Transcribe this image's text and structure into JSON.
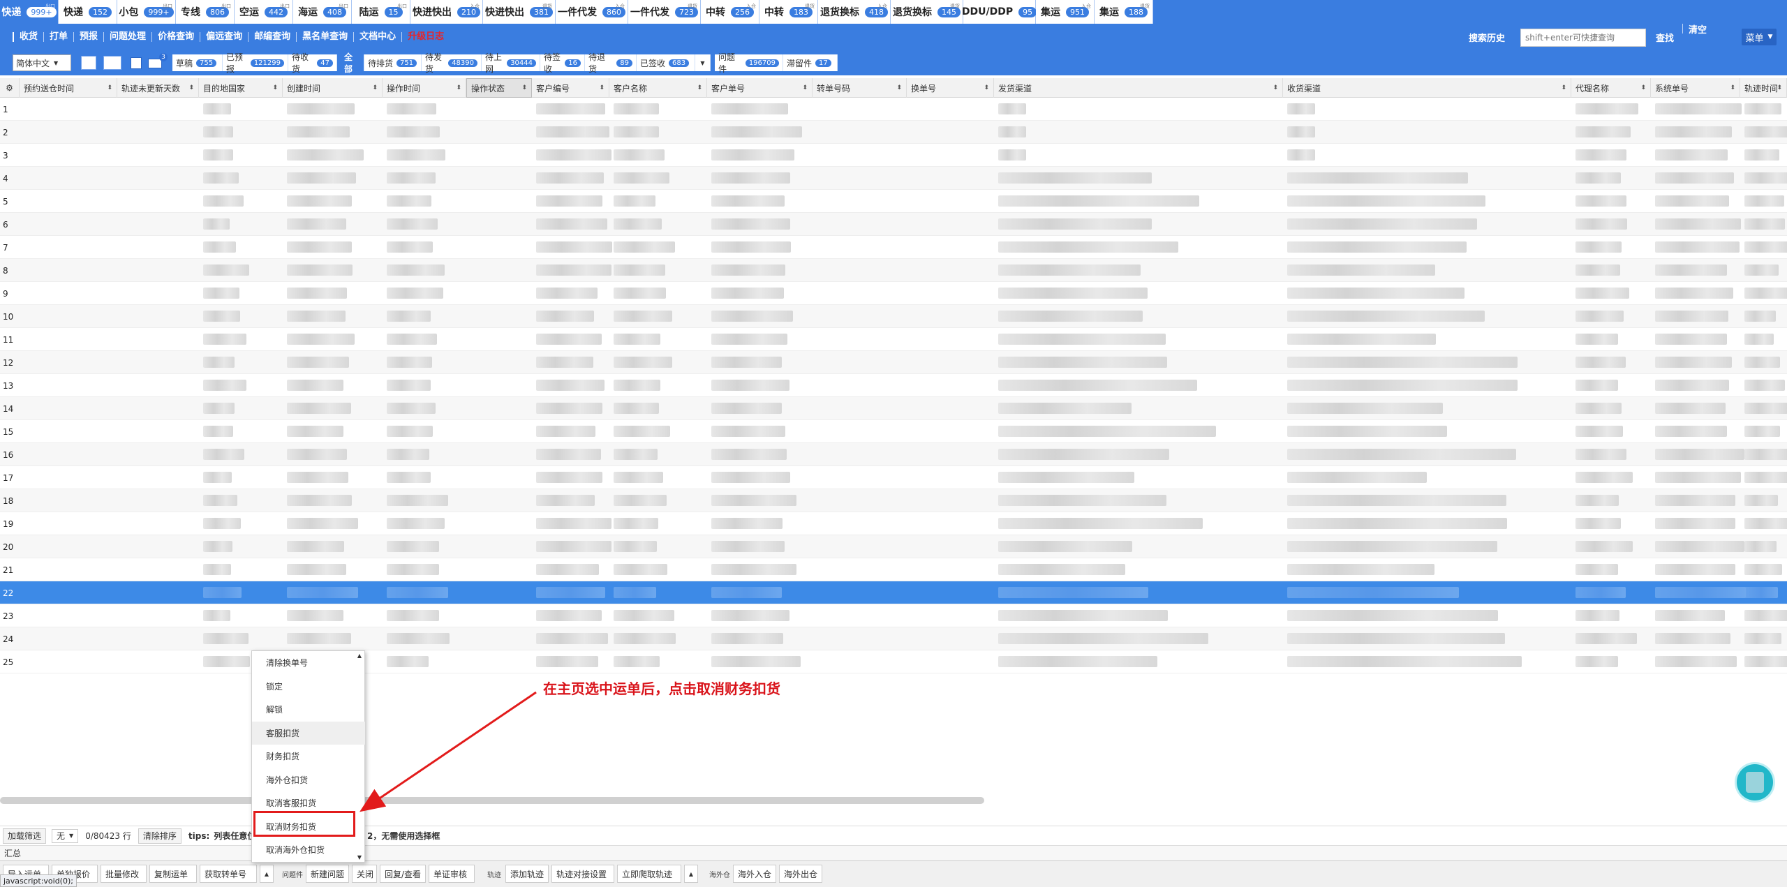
{
  "tabs": [
    {
      "label": "快递",
      "count": "999+",
      "sub": "出口",
      "active": true
    },
    {
      "label": "快递",
      "count": "152",
      "sub": "",
      "active": false
    },
    {
      "label": "小包",
      "count": "999+",
      "sub": "出口",
      "active": false
    },
    {
      "label": "专线",
      "count": "806",
      "sub": "出口",
      "active": false
    },
    {
      "label": "空运",
      "count": "442",
      "sub": "出口",
      "active": false
    },
    {
      "label": "海运",
      "count": "408",
      "sub": "出口",
      "active": false
    },
    {
      "label": "陆运",
      "count": "15",
      "sub": "出口",
      "active": false
    },
    {
      "label": "快进快出",
      "count": "210",
      "sub": "入仓",
      "active": false
    },
    {
      "label": "快进快出",
      "count": "381",
      "sub": "退货",
      "active": false
    },
    {
      "label": "一件代发",
      "count": "860",
      "sub": "入仓",
      "active": false
    },
    {
      "label": "一件代发",
      "count": "723",
      "sub": "退货",
      "active": false
    },
    {
      "label": "中转",
      "count": "256",
      "sub": "入仓",
      "active": false
    },
    {
      "label": "中转",
      "count": "183",
      "sub": "退货",
      "active": false
    },
    {
      "label": "退货换标",
      "count": "418",
      "sub": "入仓",
      "active": false
    },
    {
      "label": "退货换标",
      "count": "145",
      "sub": "退货",
      "active": false
    },
    {
      "label": "DDU/DDP",
      "count": "95",
      "sub": "",
      "active": false
    },
    {
      "label": "集运",
      "count": "951",
      "sub": "入仓",
      "active": false
    },
    {
      "label": "集运",
      "count": "188",
      "sub": "退货",
      "active": false
    }
  ],
  "menu": [
    "收货",
    "打单",
    "预报",
    "问题处理",
    "价格查询",
    "偏远查询",
    "邮编查询",
    "黑名单查询",
    "文档中心",
    "升级日志"
  ],
  "right_menu": {
    "history": "搜索历史",
    "search_placeholder": "shift+enter可快捷查询",
    "search": "查找",
    "clear": "清空",
    "menu": "菜单"
  },
  "filters": {
    "language": "简体中文",
    "mail_badge": "3",
    "status_group1": [
      {
        "label": "草稿",
        "count": "755"
      },
      {
        "label": "已预报",
        "count": "121299"
      },
      {
        "label": "待收货",
        "count": "47"
      }
    ],
    "all": "全部",
    "status_group2": [
      {
        "label": "待排货",
        "count": "751"
      },
      {
        "label": "待发货",
        "count": "48390"
      },
      {
        "label": "待上网",
        "count": "30444"
      },
      {
        "label": "待签收",
        "count": "16"
      },
      {
        "label": "待退货",
        "count": "89"
      },
      {
        "label": "已签收",
        "count": "683"
      }
    ],
    "status_group3": [
      {
        "label": "问题件",
        "count": "196709"
      },
      {
        "label": "滞留件",
        "count": "17"
      }
    ]
  },
  "columns": [
    "预约送仓时间",
    "轨迹未更新天数",
    "目的地国家",
    "创建时间",
    "操作时间",
    "操作状态",
    "客户编号",
    "客户名称",
    "客户单号",
    "转单号码",
    "换单号",
    "发货渠道",
    "收货渠道",
    "代理名称",
    "系统单号",
    "轨迹时间"
  ],
  "row_numbers": [
    "1",
    "2",
    "3",
    "4",
    "5",
    "6",
    "7",
    "8",
    "9",
    "10",
    "11",
    "12",
    "13",
    "14",
    "15",
    "16",
    "17",
    "18",
    "19",
    "20",
    "21",
    "22",
    "23",
    "24",
    "25"
  ],
  "selected_row": "22",
  "context_menu": [
    "清除换单号",
    "锁定",
    "解锁",
    "客服扣货",
    "财务扣货",
    "海外仓扣货",
    "取消客服扣货",
    "取消财务扣货",
    "取消海外仓扣货"
  ],
  "annotation": "在主页选中运单后，点击取消财务扣货",
  "status": {
    "load_filter": "加载筛选",
    "select_value": "无",
    "rows": "0/80423 行",
    "clear_sort": "清除排序",
    "tips_label": "tips:",
    "tips_text": "列表任意位",
    "tips_tail": "2，无需使用选择框",
    "summary": "汇总"
  },
  "bottom": {
    "b_left": [
      "导入运单",
      "单独报价",
      "批量修改",
      "复制运单",
      "获取转单号"
    ],
    "g_issue_label": "问题件",
    "g_issue": [
      "新建问题",
      "关闭",
      "回复/查看",
      "单证审核"
    ],
    "g_track_label": "轨迹",
    "g_track": [
      "添加轨迹",
      "轨迹对接设置",
      "立即爬取轨迹"
    ],
    "g_wh_label": "海外仓",
    "g_wh": [
      "海外入仓",
      "海外出仓"
    ]
  },
  "js_status": "javascript:void(0);"
}
